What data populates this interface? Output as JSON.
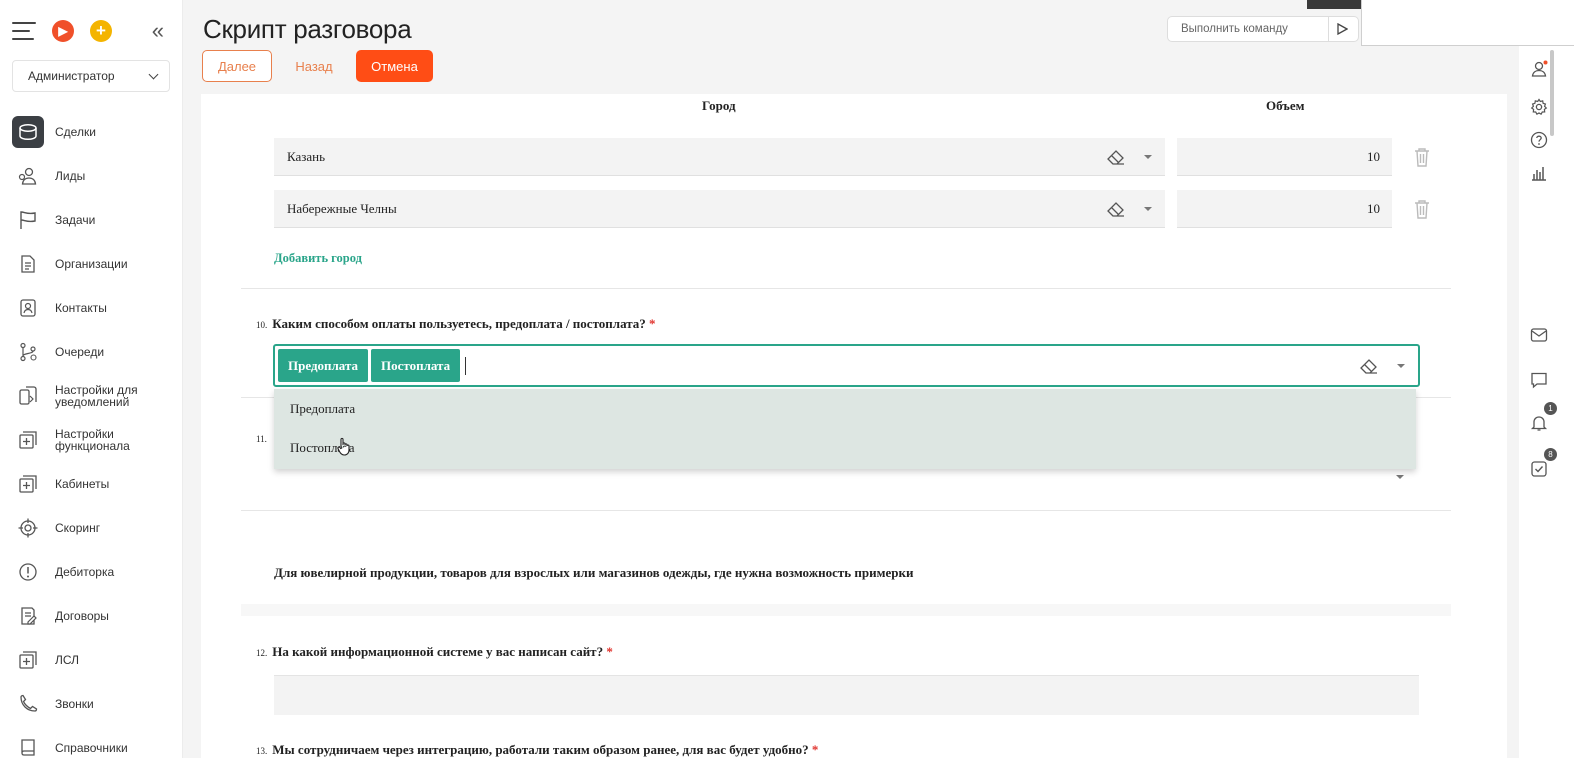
{
  "header": {
    "title": "Скрипт разговора",
    "command_placeholder": "Выполнить команду",
    "buttons": {
      "next": "Далее",
      "back": "Назад",
      "cancel": "Отмена"
    }
  },
  "sidebar": {
    "role": "Администратор",
    "items": [
      {
        "label": "Сделки",
        "icon": "deals-icon",
        "active": true
      },
      {
        "label": "Лиды",
        "icon": "leads-icon"
      },
      {
        "label": "Задачи",
        "icon": "flag-icon"
      },
      {
        "label": "Организации",
        "icon": "document-icon"
      },
      {
        "label": "Контакты",
        "icon": "contact-card-icon"
      },
      {
        "label": "Очереди",
        "icon": "branch-icon"
      },
      {
        "label": "Настройки для уведомлений",
        "icon": "notification-settings-icon"
      },
      {
        "label": "Настройки функционала",
        "icon": "plus-square-icon"
      },
      {
        "label": "Кабинеты",
        "icon": "plus-square-icon"
      },
      {
        "label": "Скоринг",
        "icon": "target-icon"
      },
      {
        "label": "Дебиторка",
        "icon": "alert-circle-icon"
      },
      {
        "label": "Договоры",
        "icon": "contract-icon"
      },
      {
        "label": "ЛСЛ",
        "icon": "plus-square-icon"
      },
      {
        "label": "Звонки",
        "icon": "phone-icon"
      },
      {
        "label": "Справочники",
        "icon": "book-icon"
      }
    ]
  },
  "form": {
    "columns": {
      "city": "Город",
      "volume": "Объем"
    },
    "rows": [
      {
        "city": "Казань",
        "volume": "10"
      },
      {
        "city": "Набережные Челны",
        "volume": "10"
      }
    ],
    "add_city": "Добавить город",
    "q10": {
      "number": "10.",
      "text": "Каким способом оплаты пользуетесь, предоплата / постоплата?",
      "required": "*"
    },
    "q10_selected": [
      "Предоплата",
      "Постоплата"
    ],
    "q10_options": [
      "Предоплата",
      "Постоплата"
    ],
    "q11": {
      "number": "11."
    },
    "info_text": "Для ювелирной продукции, товаров для взрослых или магазинов одежды, где нужна возможность примерки",
    "q12": {
      "number": "12.",
      "text": "На какой информационной системе у вас написан сайт?",
      "required": "*"
    },
    "q13": {
      "number": "13.",
      "text": "Мы сотрудничаем через интеграцию, работали таким образом ранее, для вас будет удобно?",
      "required": "*"
    }
  },
  "rightbar": {
    "icons": [
      "profile-icon",
      "settings-icon",
      "help-icon",
      "stats-icon",
      "mail-icon",
      "chat-icon",
      "bell-icon",
      "tasks-icon"
    ],
    "bell_badge": "1",
    "tasks_badge": "8"
  },
  "colors": {
    "accent": "#2aa58a",
    "cancel": "#ff4d15",
    "link_orange": "#e8804d"
  }
}
